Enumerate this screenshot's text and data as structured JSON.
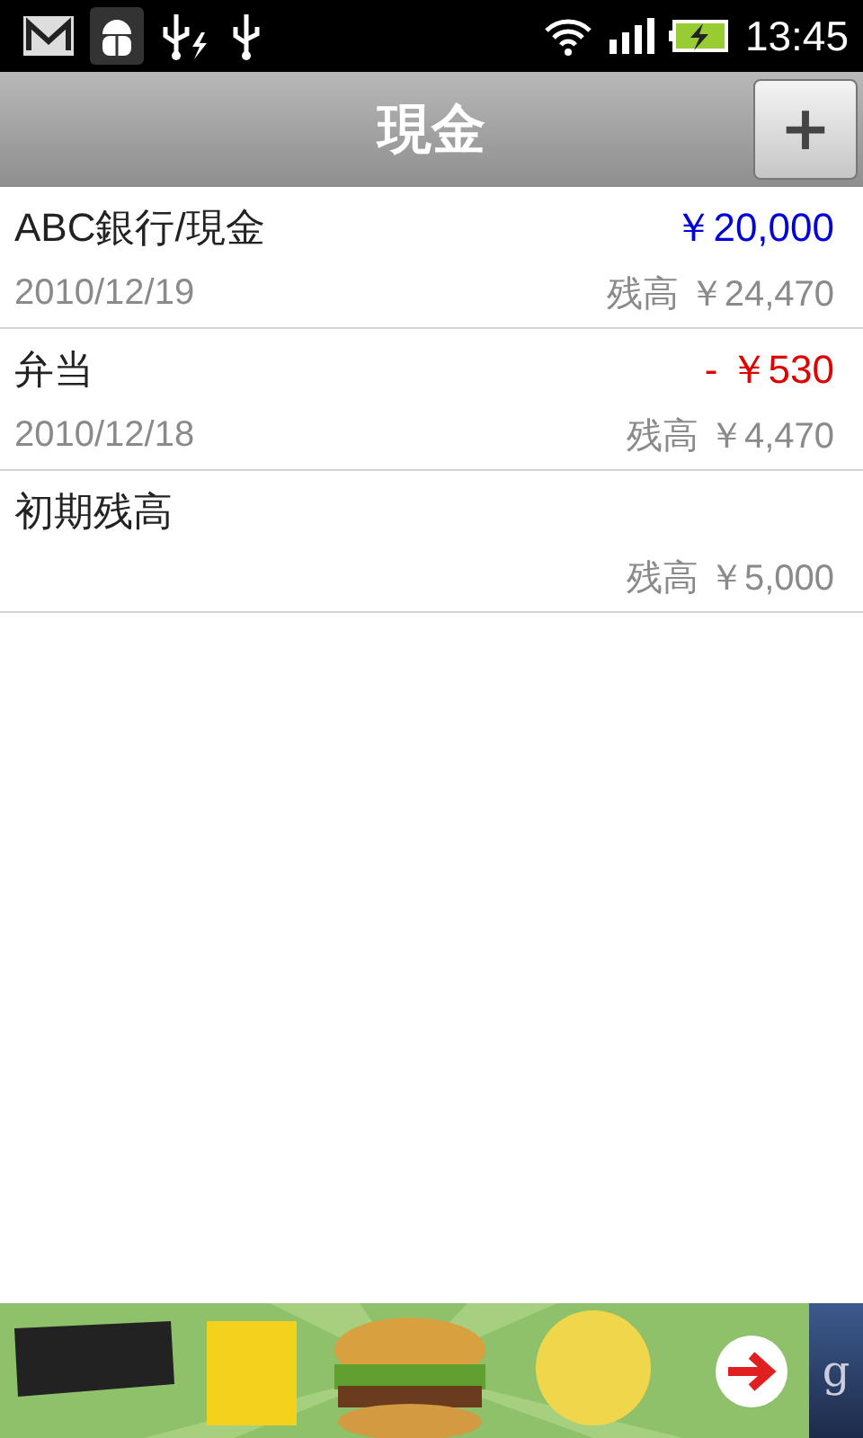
{
  "status_bar": {
    "time": "13:45"
  },
  "header": {
    "title": "現金",
    "add_button": "+"
  },
  "transactions": [
    {
      "kind": "income",
      "name": "ABC銀行/現金",
      "amount": "￥20,000",
      "date": "2010/12/19",
      "balance": "残高 ￥24,470"
    },
    {
      "kind": "expense",
      "name": "弁当",
      "amount": "- ￥530",
      "date": "2010/12/18",
      "balance": "残高 ￥4,470"
    },
    {
      "kind": "opening",
      "name": "初期残高",
      "balance": "残高 ￥5,000"
    }
  ],
  "ad_banner": {
    "kind": "picture",
    "badge": "g"
  }
}
